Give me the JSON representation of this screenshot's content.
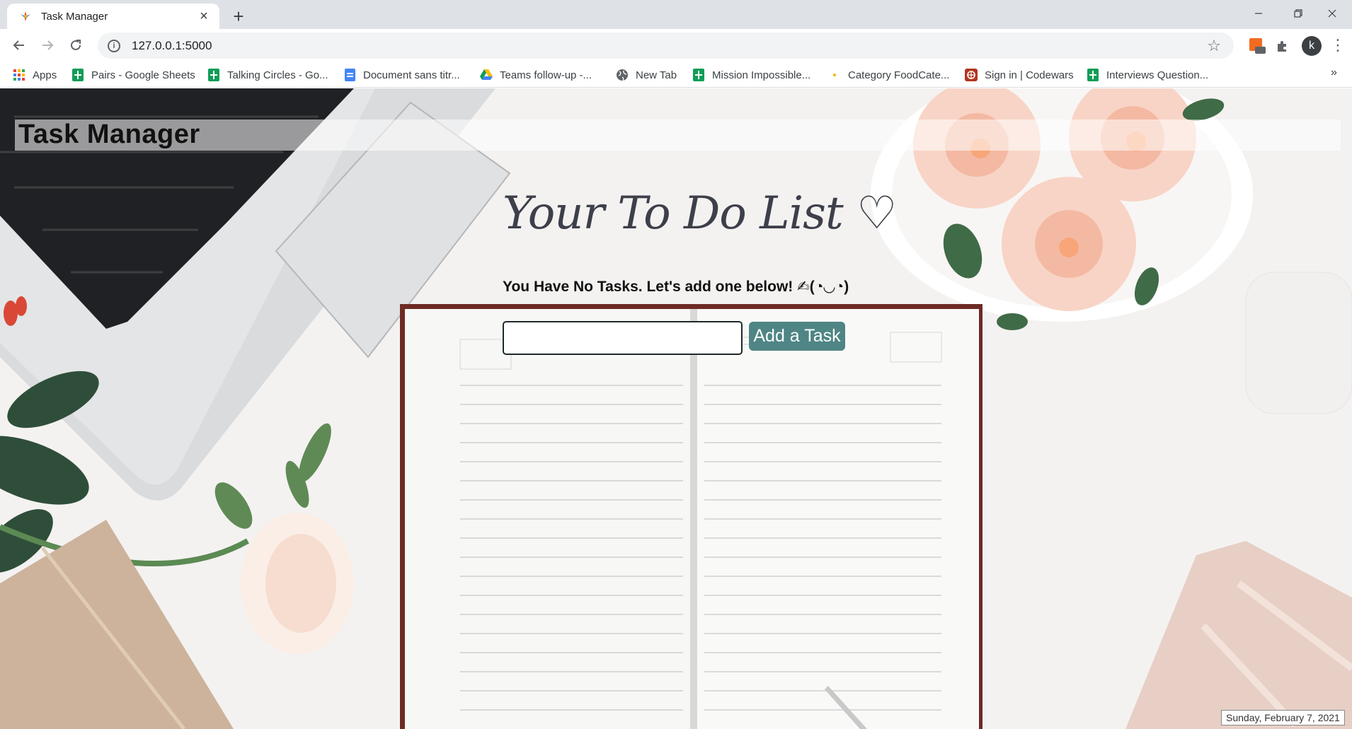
{
  "browser": {
    "tab_title": "Task Manager",
    "url": "127.0.0.1:5000",
    "extension_badge": "off",
    "profile_initial": "k"
  },
  "bookmarks": [
    {
      "label": "Apps",
      "icon": "apps-grid-icon"
    },
    {
      "label": "Pairs - Google Sheets",
      "icon": "sheets-icon"
    },
    {
      "label": "Talking Circles - Go...",
      "icon": "sheets-icon"
    },
    {
      "label": "Document sans titr...",
      "icon": "docs-icon"
    },
    {
      "label": "Teams follow-up -...",
      "icon": "drive-icon"
    },
    {
      "label": "New Tab",
      "icon": "globe-icon"
    },
    {
      "label": "Mission Impossible...",
      "icon": "sheets-icon"
    },
    {
      "label": "Category FoodCate...",
      "icon": "dot-icon"
    },
    {
      "label": "Sign in | Codewars",
      "icon": "codewars-icon"
    },
    {
      "label": "Interviews Question...",
      "icon": "sheets-icon"
    }
  ],
  "page": {
    "site_title": "Task Manager",
    "list_heading": "Your To Do List ♡",
    "empty_message": "You Have No Tasks. Let's add one below! ✍(◔◡◔)",
    "task_input_value": "",
    "add_button_label": "Add a Task",
    "date_tooltip": "Sunday, February 7, 2021"
  },
  "colors": {
    "button_bg": "#4f8585",
    "background": "#f4f2f1",
    "heading": "#3d3f4a"
  }
}
